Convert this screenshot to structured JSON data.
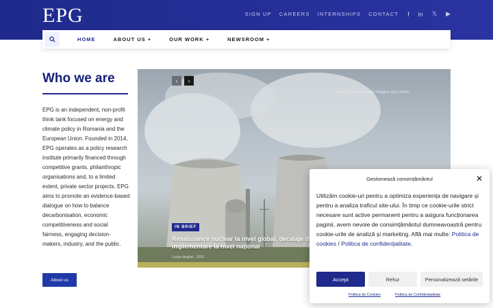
{
  "header": {
    "logo": "EPG",
    "links": [
      "SIGN UP",
      "CAREERS",
      "INTERNSHIPS",
      "CONTACT"
    ],
    "social_icons": [
      "facebook-icon",
      "linkedin-icon",
      "x-icon",
      "youtube-icon"
    ]
  },
  "nav": {
    "items": [
      "HOME",
      "ABOUT US +",
      "OUR WORK +",
      "NEWSROOM +"
    ]
  },
  "about": {
    "title": "Who we are",
    "text": "EPG is an independent, non-profit think tank focused on energy and climate policy in Romania and the European Union. Founded in 2014, EPG operates as a policy research institute primarily financed through competitive grants, philanthropic organisations and, to a limited extent, private sector projects. EPG aims to promote an evidence-based dialogue on how to balance decarbonisation, economic competitiveness and social fairness, engaging decision-makers, industry, and the public.",
    "button": "About us"
  },
  "hero": {
    "credit": "ebel1101ob on Getty Images via Canva",
    "badge": "IN BRIEF",
    "title": "Renaissance nuclear la nivel global, decalaje de implementare la nivel național",
    "subtitle": "Lucian Anghel · 2025"
  },
  "cookie": {
    "title": "Gestionează consimțământul",
    "body_text": "Utilizăm cookie-uri pentru a optimiza experiența de navigare și pentru a analiza traficul site-ului. În timp ce cookie-urile strict necesare sunt active permanent pentru a asigura funcționarea paginii, avem nevoie de consimțământul dumneavoastră pentru cookie-urile de analiză și marketing. Află mai multe: ",
    "link1": "Politica de cookies",
    "separator": " / ",
    "link2": "Politica de confidențialitate",
    "period": ".",
    "accept": "Accept",
    "refuse": "Refuz",
    "customize": "Personalizează setările",
    "footer_link1": "Politica de Cookies",
    "footer_link2": "Politica de Confidențialitate"
  },
  "colors": {
    "brand": "#1f2a8c",
    "accent_button": "#1f3aa8"
  }
}
